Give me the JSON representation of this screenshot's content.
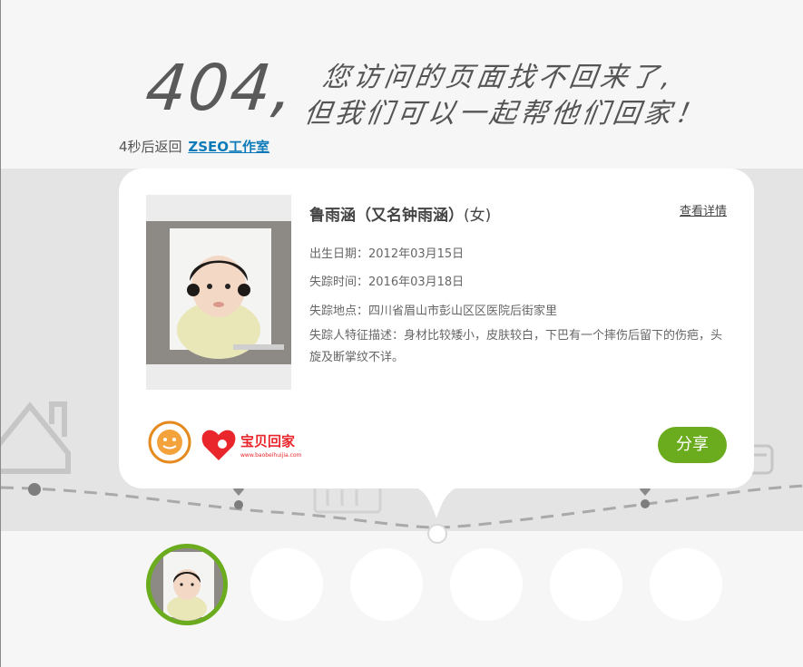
{
  "hero": {
    "code": "404,",
    "line1": "您访问的页面找不回来了,",
    "line2": "但我们可以一起帮他们回家！"
  },
  "countdown": {
    "text": "4秒后返回",
    "link_label": "ZSEO工作室"
  },
  "card": {
    "name": "鲁雨涵（又名钟雨涵）",
    "gender": "(女)",
    "details_link": "查看详情",
    "birth": "出生日期：2012年03月15日",
    "missing_time": "失踪时间：2016年03月18日",
    "missing_place": "失踪地点：四川省眉山市彭山区区医院后街家里",
    "features": "失踪人特征描述：身材比较矮小，皮肤较白，下巴有一个摔伤后留下的伤疤，头旋及断掌纹不详。",
    "share_label": "分享",
    "logo_baobei_text": "宝贝回家",
    "logo_baobei_url": "www.baobeihuijia.com"
  },
  "colors": {
    "accent_green": "#6aac1e",
    "link_blue": "#0c7bb8"
  },
  "thumbs": [
    {
      "active": true
    },
    {
      "active": false
    },
    {
      "active": false
    },
    {
      "active": false
    },
    {
      "active": false
    },
    {
      "active": false
    }
  ]
}
